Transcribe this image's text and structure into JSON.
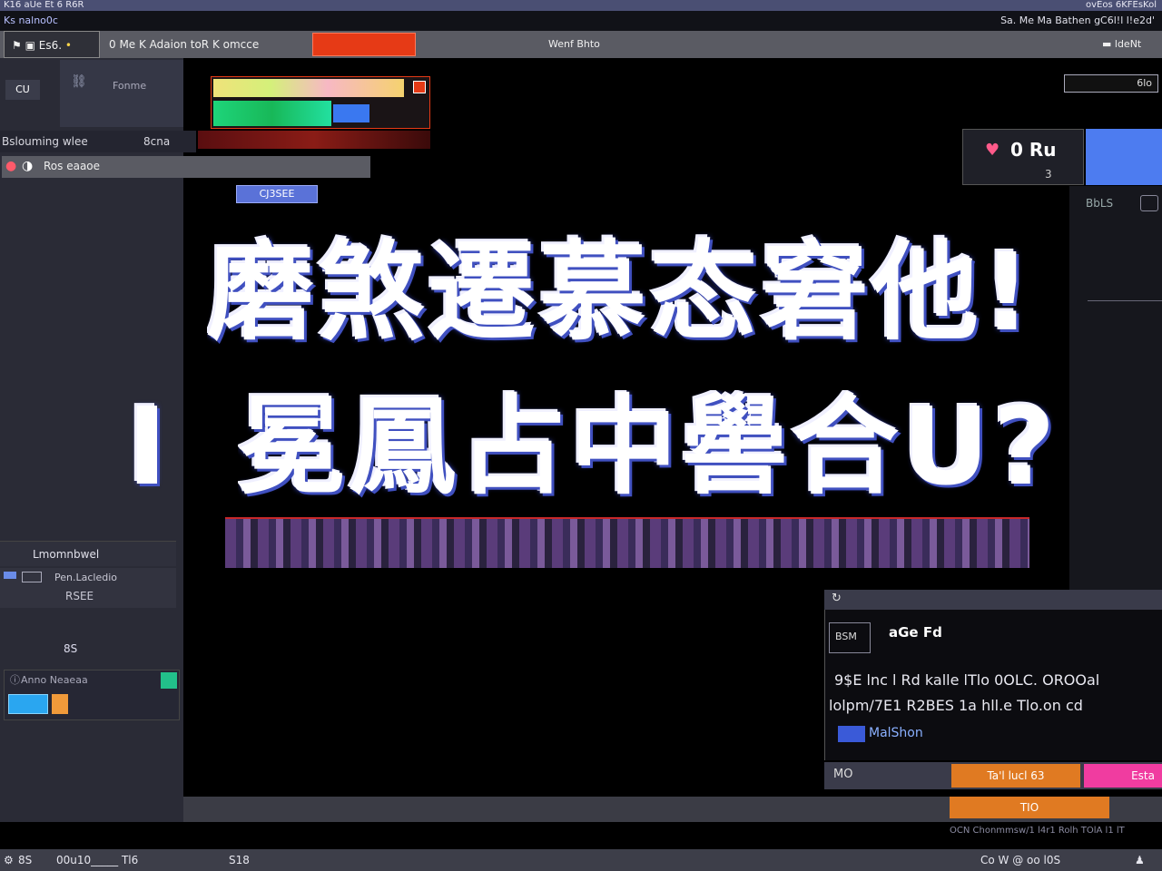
{
  "title_bar": {
    "left_text": "K16 aUe Et 6  R6R",
    "right_text": "ovEos  6KFEsKol"
  },
  "menu_bar": {
    "left_text": "Ks nalno0c",
    "right_text": "Sa. Me Ma  Bathen gC6l!l l!e2d'"
  },
  "tabs": {
    "tab1_label": "Es6.",
    "tab2_label": "0  Me K   Adaion  toR  K  omcce",
    "center_label": "Wenf Bhto",
    "right_label": "ldeNt"
  },
  "toolbar": {
    "button_left": "CU",
    "item_label": "Fonme",
    "right_field_value": "6lo"
  },
  "left_panel": {
    "section_header": "Bslouming wlee",
    "section_count": "8cna",
    "row_label": "Ros eaaoe",
    "tag_badge": "CJ3SEE",
    "lower_header": "Lmomnbwel",
    "lower_row_label": "Pen.Lacledio",
    "lower_row_value": "RSEE",
    "small_label": "8S",
    "bottom_item_label": "Anno Neaeaa"
  },
  "preview_badge": {
    "value": "0 Ru",
    "sub": "3"
  },
  "right_panel": {
    "label": "BbLS"
  },
  "main": {
    "headline_line1": "磨​煞​遷​慕​态​窘​他!",
    "headline_line2": "冕​鳳​占​中​嚳​合​U?",
    "headline_mark": "I"
  },
  "info_panel": {
    "header_icon": "refresh-icon",
    "tag": "BSM",
    "title": "aGe Fd",
    "line1": "9$E lnc l Rd  kalle lTlo  0OLC. OROOal",
    "line2": "lolpm/7E1   R2BES   1a hll.e Tlo.on cd",
    "link_text": "MalShon",
    "footer_left": "MO",
    "footer_middle": "Ta'l lucl 63",
    "footer_right": "Esta",
    "orange_button": "TIO"
  },
  "bottom_strip": {
    "text": "OCN  Chonmmsw/1 l4r1 Rolh  TOlA l1 lT"
  },
  "status_bar": {
    "left_item1": "8S",
    "left_item2": "00u10_____ Tl6",
    "left_item3": "S18",
    "right_text": "Co W  @  oo  l0S"
  },
  "colors": {
    "accent_red": "#e63a16",
    "accent_blue": "#4d7cf0",
    "accent_pink": "#f03ca0",
    "accent_orange": "#e07a22",
    "accent_green": "#22c08a"
  }
}
